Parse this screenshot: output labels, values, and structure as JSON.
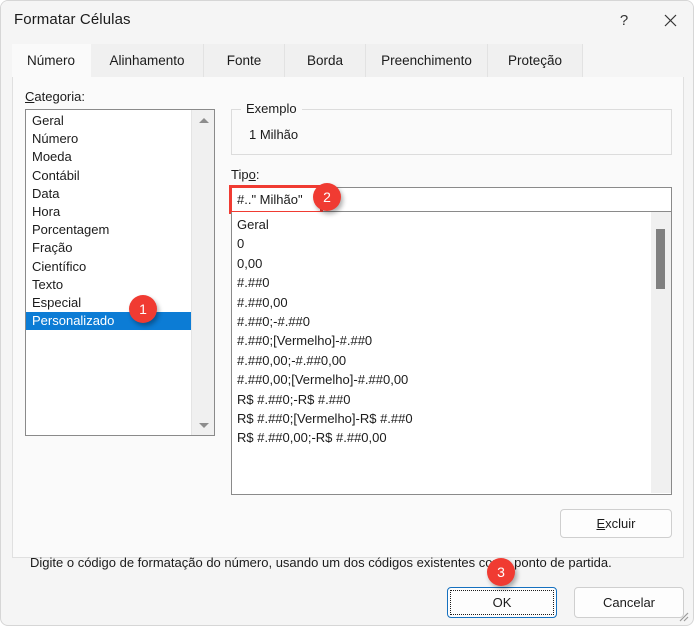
{
  "window": {
    "title": "Formatar Células",
    "help_icon": "question-mark-icon",
    "close_icon": "close-x-icon"
  },
  "tabs": [
    {
      "label": "Número",
      "selected": true
    },
    {
      "label": "Alinhamento",
      "selected": false
    },
    {
      "label": "Fonte",
      "selected": false
    },
    {
      "label": "Borda",
      "selected": false
    },
    {
      "label": "Preenchimento",
      "selected": false
    },
    {
      "label": "Proteção",
      "selected": false
    }
  ],
  "category": {
    "label": "Categoria:",
    "items": [
      "Geral",
      "Número",
      "Moeda",
      "Contábil",
      "Data",
      "Hora",
      "Porcentagem",
      "Fração",
      "Científico",
      "Texto",
      "Especial",
      "Personalizado"
    ],
    "selected": "Personalizado",
    "scroll_up_icon": "triangle-up-icon",
    "scroll_down_icon": "triangle-down-icon"
  },
  "example": {
    "legend": "Exemplo",
    "value": "1 Milhão"
  },
  "tipo": {
    "label_prefix": "Tip",
    "label_accel": "o",
    "label_suffix": ":",
    "value": "#..\" Milhão\"",
    "placeholder": ""
  },
  "format_codes": [
    "Geral",
    "0",
    "0,00",
    "#.##0",
    "#.##0,00",
    "#.##0;-#.##0",
    "#.##0;[Vermelho]-#.##0",
    "#.##0,00;-#.##0,00",
    "#.##0,00;[Vermelho]-#.##0,00",
    "R$ #.##0;-R$ #.##0",
    "R$ #.##0;[Vermelho]-R$ #.##0",
    "R$ #.##0,00;-R$ #.##0,00"
  ],
  "buttons": {
    "excluir_accel": "E",
    "excluir_rest": "xcluir",
    "ok": "OK",
    "cancel": "Cancelar"
  },
  "hint": "Digite o código de formatação do número, usando um dos códigos existentes como ponto de partida.",
  "callouts": [
    {
      "number": "1"
    },
    {
      "number": "2"
    },
    {
      "number": "3"
    }
  ],
  "colors": {
    "selection_blue": "#0c7cd5",
    "callout_red": "#f03b32",
    "focus_blue": "#1570bf"
  }
}
